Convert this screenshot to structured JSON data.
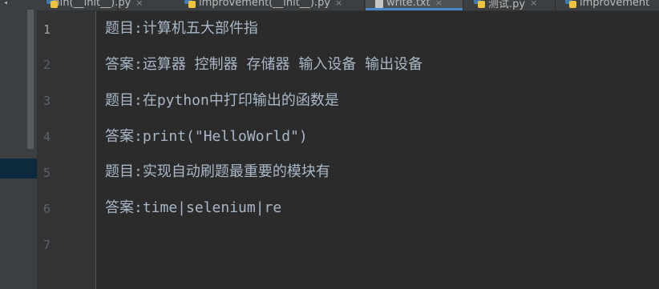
{
  "tabs": [
    {
      "label": "min(__init__).py",
      "icon": "python-file-icon",
      "active": false
    },
    {
      "label": "improvement(__init__).py",
      "icon": "python-file-icon",
      "active": false
    },
    {
      "label": "write.txt",
      "icon": "text-file-icon",
      "active": true
    },
    {
      "label": "测试.py",
      "icon": "python-file-icon",
      "active": false
    },
    {
      "label": "improvement",
      "icon": "python-file-icon",
      "active": false
    }
  ],
  "gutter": {
    "line_numbers": [
      "1",
      "2",
      "3",
      "4",
      "5",
      "6",
      "7"
    ],
    "current_line": "1"
  },
  "editor": {
    "lines": [
      "题目:计算机五大部件指",
      "答案:运算器 控制器 存储器 输入设备 输出设备",
      "题目:在python中打印输出的函数是",
      "答案:print(\"HelloWorld\")",
      "题目:实现自动刷题最重要的模块有",
      "答案:time|selenium|re",
      ""
    ]
  },
  "colors": {
    "editor_bg": "#2b2b2b",
    "gutter_bg": "#313335",
    "text": "#a9b7c6",
    "line_number": "#606366",
    "active_tab_underline": "#4a88c7"
  }
}
